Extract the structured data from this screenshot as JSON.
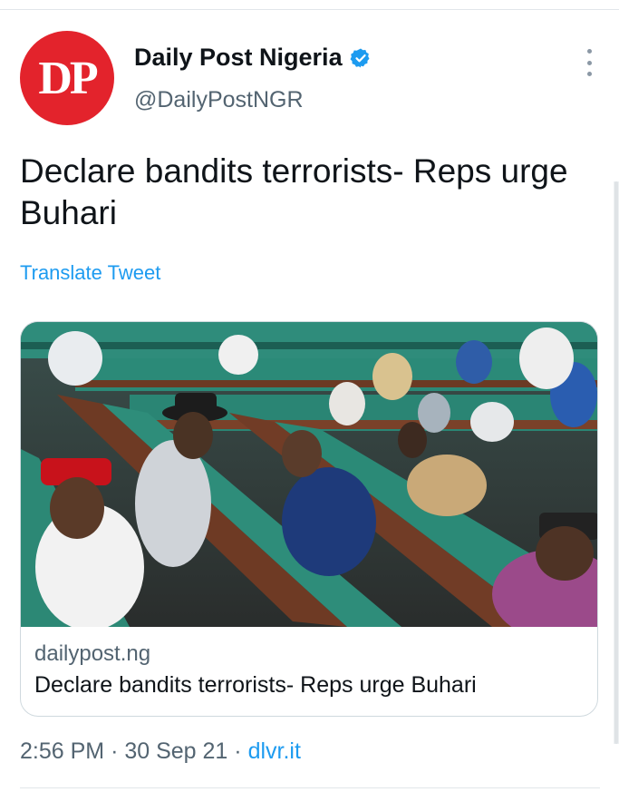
{
  "account": {
    "avatar_text": "DP",
    "display_name": "Daily Post Nigeria",
    "handle": "@DailyPostNGR",
    "verified": true
  },
  "tweet": {
    "text": "Declare bandits terrorists- Reps urge Buhari",
    "translate_label": "Translate Tweet"
  },
  "card": {
    "domain": "dailypost.ng",
    "title": "Declare bandits terrorists- Reps urge Buhari"
  },
  "meta": {
    "time": "2:56 PM",
    "separator": "·",
    "date": "30 Sep 21",
    "source": "dlvr.it"
  },
  "colors": {
    "brand_red": "#e3232c",
    "link_blue": "#1d9bf0",
    "secondary_text": "#536471"
  }
}
